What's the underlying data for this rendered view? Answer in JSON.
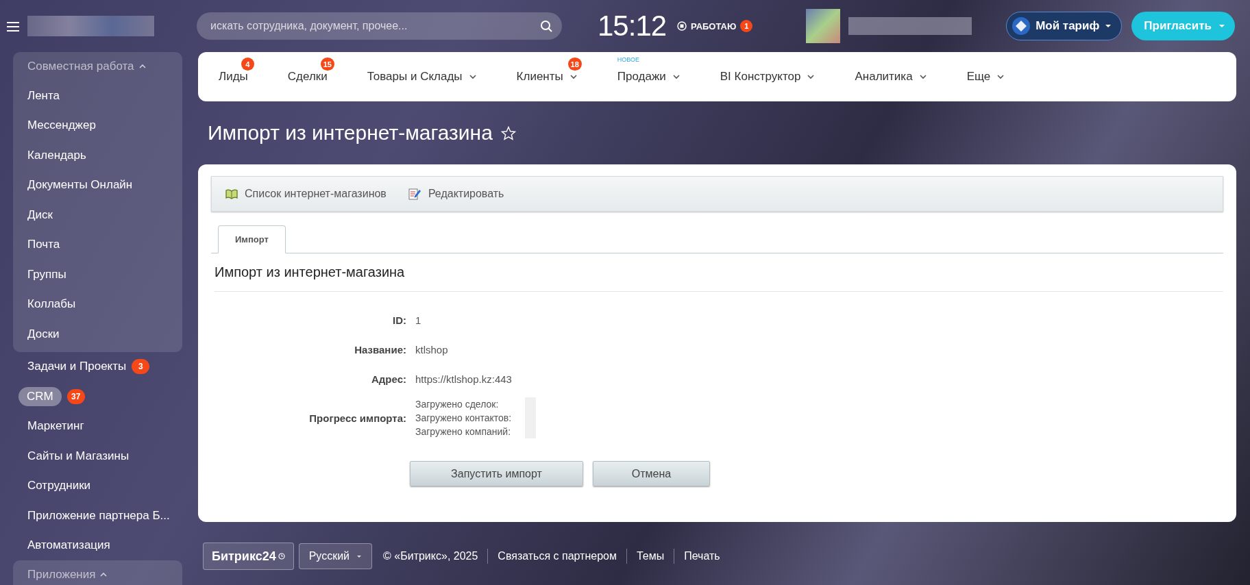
{
  "top_bar": {
    "search": {
      "placeholder": "искать сотрудника, документ, прочее..."
    },
    "clock": "15:12",
    "work_status": {
      "label": "РАБОТАЮ",
      "count": "1"
    },
    "tariff_button": "Мой тариф",
    "invite_button": "Пригласить"
  },
  "nav": [
    {
      "label": "Лиды",
      "badge": "4",
      "dropdown": false
    },
    {
      "label": "Сделки",
      "badge": "15",
      "dropdown": false
    },
    {
      "label": "Товары и Склады",
      "dropdown": true
    },
    {
      "label": "Клиенты",
      "badge": "18",
      "dropdown": true
    },
    {
      "label": "Продажи",
      "tag": "НОВОЕ",
      "dropdown": true
    },
    {
      "label": "BI Конструктор",
      "dropdown": true
    },
    {
      "label": "Аналитика",
      "dropdown": true
    },
    {
      "label": "Еще",
      "dropdown": true
    }
  ],
  "sidebar": {
    "items": [
      {
        "kind": "group",
        "label": "Совместная работа",
        "expanded": true,
        "children": [
          {
            "label": "Лента",
            "selected": false
          },
          {
            "label": "Мессенджер",
            "selected": false
          },
          {
            "label": "Календарь",
            "selected": false
          },
          {
            "label": "Документы Онлайн",
            "selected": false
          },
          {
            "label": "Диск",
            "selected": false
          },
          {
            "label": "Почта",
            "selected": false
          },
          {
            "label": "Группы",
            "selected": false
          },
          {
            "label": "Коллабы",
            "selected": false
          },
          {
            "label": "Доски",
            "selected": false
          }
        ]
      },
      {
        "kind": "item",
        "label": "Задачи и Проекты",
        "badge": "3",
        "selected": false
      },
      {
        "kind": "item",
        "label": "CRM",
        "badge": "37",
        "selected": true
      },
      {
        "kind": "item",
        "label": "Маркетинг",
        "selected": false
      },
      {
        "kind": "item",
        "label": "Сайты и Магазины",
        "selected": false
      },
      {
        "kind": "item",
        "label": "Сотрудники",
        "selected": false
      },
      {
        "kind": "item",
        "label": "Приложение партнера Б...",
        "selected": false
      },
      {
        "kind": "item",
        "label": "Автоматизация",
        "selected": false
      },
      {
        "kind": "group",
        "label": "Приложения",
        "expanded": true
      }
    ]
  },
  "page_title": "Импорт из интернет-магазина",
  "toolbar": [
    {
      "kind": "book",
      "label": "Список интернет-магазинов"
    },
    {
      "kind": "edit",
      "label": "Редактировать"
    }
  ],
  "tabs": [
    {
      "label": "Импорт",
      "selected": true
    }
  ],
  "form": {
    "title": "Импорт из интернет-магазина",
    "fields": [
      {
        "label": "ID:",
        "value": "1"
      },
      {
        "label": "Название:",
        "value": "ktlshop"
      },
      {
        "label": "Адрес:",
        "value": "https://ktlshop.kz:443"
      }
    ],
    "progress": {
      "label": "Прогресс импорта:",
      "lines": [
        "Загружено сделок:",
        "Загружено контактов:",
        "Загружено компаний:"
      ]
    },
    "buttons": [
      "Запустить импорт",
      "Отмена"
    ]
  },
  "footer": {
    "logo": "Битрикс24",
    "language": "Русский",
    "copyright": "© «Битрикс», 2025",
    "links": [
      "Связаться с партнером",
      "Темы",
      "Печать"
    ]
  }
}
